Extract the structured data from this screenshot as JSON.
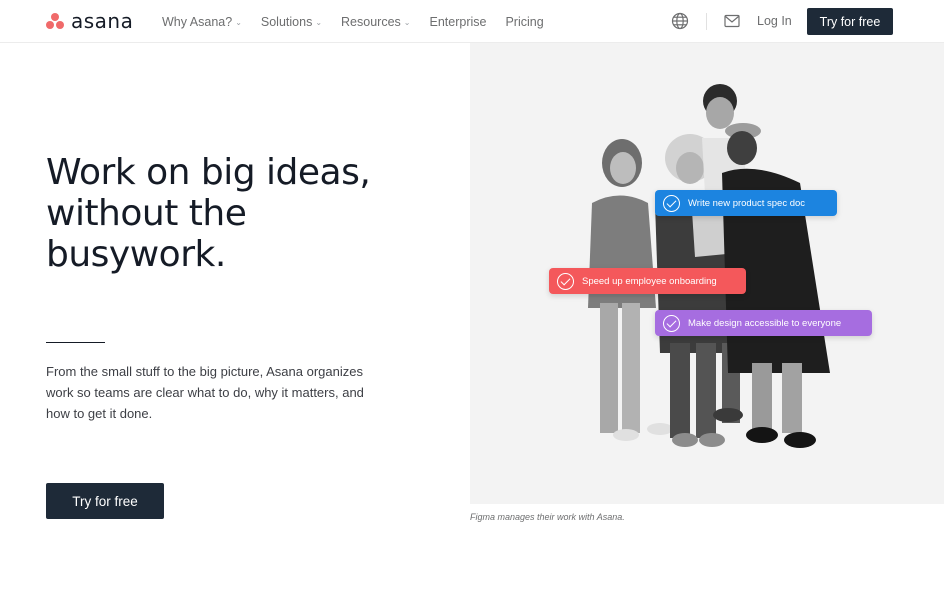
{
  "brand": {
    "name": "asana",
    "logo_color": "#f06a6a"
  },
  "nav": {
    "links": [
      {
        "label": "Why Asana?",
        "has_dropdown": true
      },
      {
        "label": "Solutions",
        "has_dropdown": true
      },
      {
        "label": "Resources",
        "has_dropdown": true
      },
      {
        "label": "Enterprise",
        "has_dropdown": false
      },
      {
        "label": "Pricing",
        "has_dropdown": false
      }
    ],
    "language_icon": "globe-icon",
    "contact_icon": "mail-icon",
    "login_label": "Log In",
    "cta_label": "Try for free"
  },
  "hero": {
    "title": "Work on big ideas, without the busywork.",
    "description": "From the small stuff to the big picture, Asana organizes work so teams are clear what to do, why it matters, and how to get it done.",
    "cta_label": "Try for free",
    "caption": "Figma manages their work with Asana.",
    "tasks": [
      {
        "label": "Write new product spec doc",
        "color": "#1c84e0"
      },
      {
        "label": "Speed up employee onboarding",
        "color": "#f4585b"
      },
      {
        "label": "Make design accessible to everyone",
        "color": "#a66de0"
      }
    ]
  },
  "colors": {
    "dark_button": "#1e2a38",
    "text": "#151b26"
  }
}
